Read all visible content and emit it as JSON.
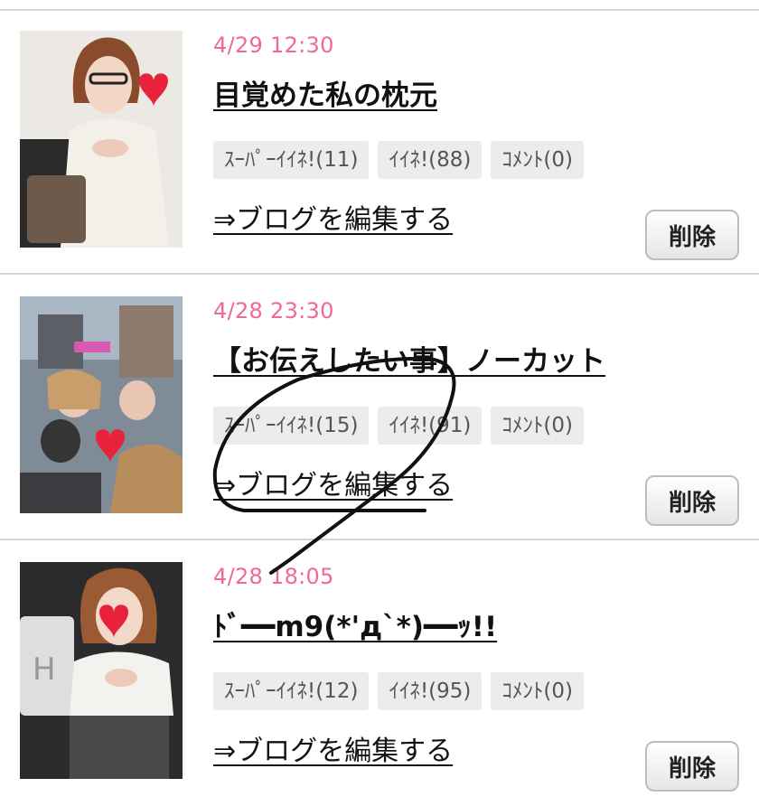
{
  "entries": [
    {
      "date": "4/29 12:30",
      "title": "目覚めた私の枕元",
      "tags": [
        "ｽｰﾊﾟｰｲｲﾈ!(11)",
        "ｲｲﾈ!(88)",
        "ｺﾒﾝﾄ(0)"
      ],
      "edit_link": "⇒ブログを編集する",
      "delete_label": "削除"
    },
    {
      "date": "4/28 23:30",
      "title": "【お伝えしたい事】ノーカット",
      "tags": [
        "ｽｰﾊﾟｰｲｲﾈ!(15)",
        "ｲｲﾈ!(91)",
        "ｺﾒﾝﾄ(0)"
      ],
      "edit_link": "⇒ブログを編集する",
      "delete_label": "削除"
    },
    {
      "date": "4/28 18:05",
      "title": "ﾄﾞ━━m9(*'д`*)━━ｯ!!",
      "tags": [
        "ｽｰﾊﾟｰｲｲﾈ!(12)",
        "ｲｲﾈ!(95)",
        "ｺﾒﾝﾄ(0)"
      ],
      "edit_link": "⇒ブログを編集する",
      "delete_label": "削除"
    }
  ],
  "colors": {
    "date": "#f0679a",
    "tag_bg": "#ececec",
    "divider": "#d6d6d6",
    "heart_sticker": "#e8223a"
  },
  "icons": {
    "face_cover": "heart-sticker-icon",
    "annotation": "hand-drawn-scribble"
  }
}
